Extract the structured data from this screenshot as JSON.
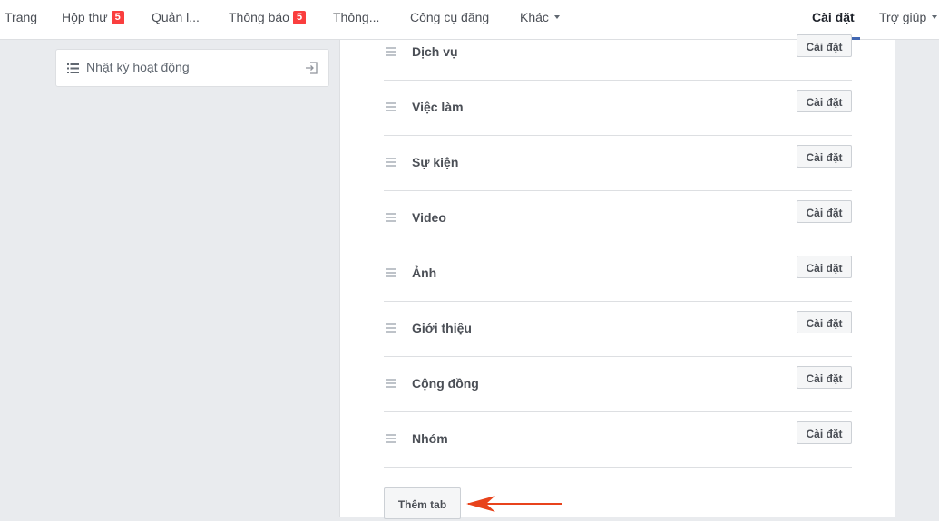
{
  "nav": {
    "items": [
      {
        "label": "Trang"
      },
      {
        "label": "Hộp thư",
        "badge": "5"
      },
      {
        "label": "Quản l..."
      },
      {
        "label": "Thông báo",
        "badge": "5"
      },
      {
        "label": "Thông..."
      },
      {
        "label": "Công cụ đăng"
      },
      {
        "label": "Khác",
        "icon": "caret-down-icon"
      },
      {
        "label": "Cài đặt",
        "active": true
      },
      {
        "label": "Trợ giúp",
        "icon": "caret-down-icon"
      }
    ]
  },
  "sidebar": {
    "activity_log": {
      "label": "Nhật ký hoạt động",
      "icon": "list-icon",
      "action_icon": "exit-icon"
    }
  },
  "tabs": [
    {
      "name": "Dịch vụ",
      "button": "Cài đặt"
    },
    {
      "name": "Việc làm",
      "button": "Cài đặt"
    },
    {
      "name": "Sự kiện",
      "button": "Cài đặt"
    },
    {
      "name": "Video",
      "button": "Cài đặt"
    },
    {
      "name": "Ảnh",
      "button": "Cài đặt"
    },
    {
      "name": "Giới thiệu",
      "button": "Cài đặt"
    },
    {
      "name": "Cộng đồng",
      "button": "Cài đặt"
    },
    {
      "name": "Nhóm",
      "button": "Cài đặt"
    }
  ],
  "add_tab_button": "Thêm tab",
  "colors": {
    "accent": "#4267b2",
    "badge": "#fa3e3e",
    "arrow": "#e8431c"
  }
}
